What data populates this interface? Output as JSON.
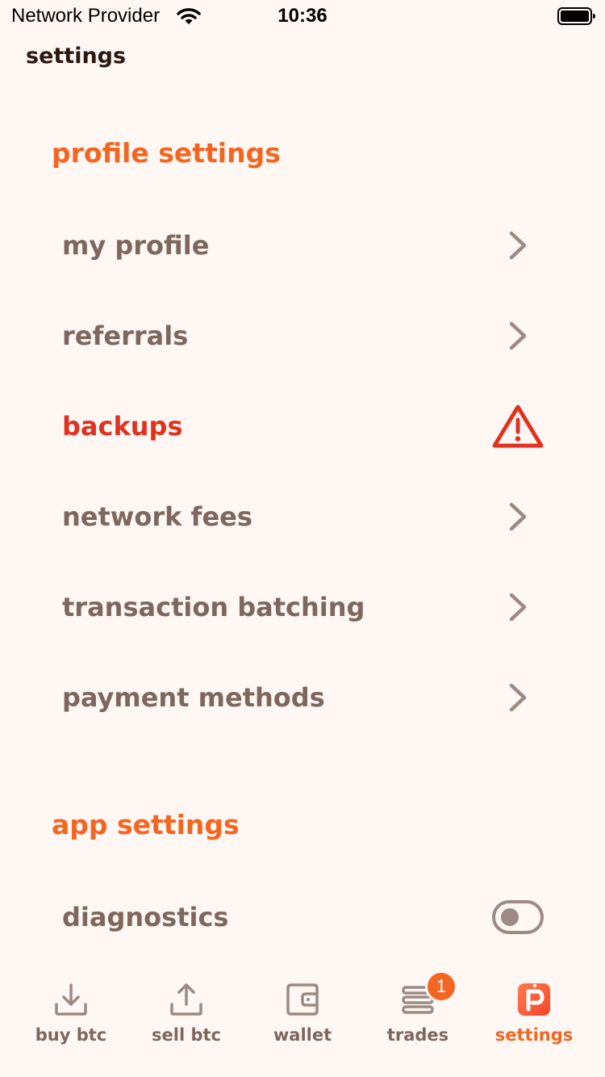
{
  "status_bar": {
    "carrier": "Network Provider",
    "time": "10:36",
    "icons": [
      "wifi-icon",
      "battery-icon"
    ]
  },
  "header": {
    "title": "settings"
  },
  "sections": {
    "profile": {
      "heading": "profile settings",
      "items": [
        {
          "label": "my profile",
          "trailing": "chevron-right-icon"
        },
        {
          "label": "referrals",
          "trailing": "chevron-right-icon"
        },
        {
          "label": "backups",
          "trailing": "warning-icon",
          "state": "warning"
        },
        {
          "label": "network fees",
          "trailing": "chevron-right-icon"
        },
        {
          "label": "transaction batching",
          "trailing": "chevron-right-icon"
        },
        {
          "label": "payment methods",
          "trailing": "chevron-right-icon"
        }
      ]
    },
    "app": {
      "heading": "app settings",
      "items": [
        {
          "label": "diagnostics",
          "trailing": "toggle",
          "toggle_on": false
        }
      ]
    }
  },
  "bottom_nav": {
    "items": [
      {
        "label": "buy btc",
        "icon": "download-icon",
        "active": false
      },
      {
        "label": "sell btc",
        "icon": "upload-icon",
        "active": false
      },
      {
        "label": "wallet",
        "icon": "wallet-icon",
        "active": false
      },
      {
        "label": "trades",
        "icon": "trades-icon",
        "active": false,
        "badge": "1"
      },
      {
        "label": "settings",
        "icon": "peach-logo-icon",
        "active": true
      }
    ]
  },
  "colors": {
    "background": "#FEF7F3",
    "accent": "#F56522",
    "text_muted": "#7D675E",
    "warning": "#DF321F",
    "title": "#2B1911"
  }
}
